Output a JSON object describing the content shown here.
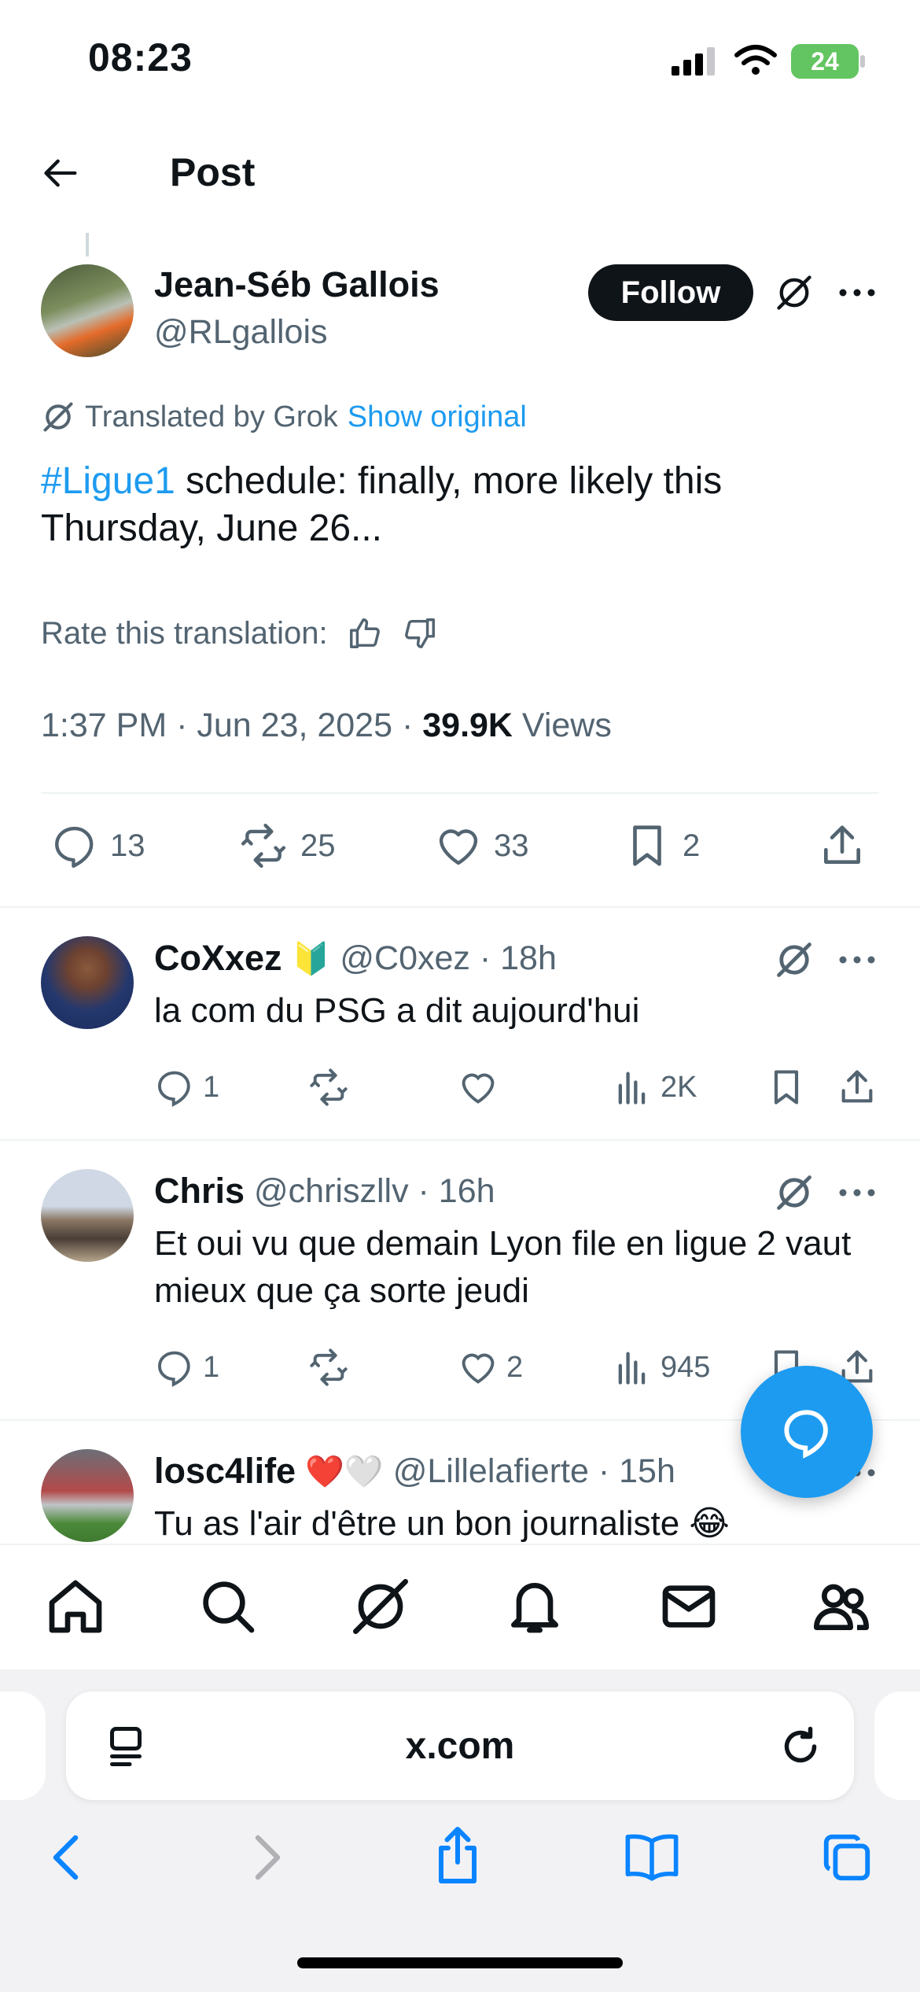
{
  "status_bar": {
    "time": "08:23",
    "battery": "24"
  },
  "header": {
    "title": "Post"
  },
  "post": {
    "author_name": "Jean-Séb Gallois",
    "author_handle": "@RLgallois",
    "follow_label": "Follow",
    "translated_by": "Translated by Grok",
    "show_original": "Show original",
    "hashtag": "#Ligue1",
    "text": " schedule: finally, more likely this Thursday, June 26...",
    "rate_label": "Rate this translation:",
    "meta_prefix": "1:37 PM · Jun 23, 2025 · ",
    "views_count": "39.9K",
    "views_label": " Views",
    "stats": {
      "replies": "13",
      "reposts": "25",
      "likes": "33",
      "bookmarks": "2"
    }
  },
  "replies": [
    {
      "name": "CoXxez",
      "badge": "🔰",
      "meta": "@C0xez · 18h",
      "text": "la com du PSG a dit aujourd'hui",
      "replies": "1",
      "reposts": "",
      "likes": "",
      "views": "2K"
    },
    {
      "name": "Chris",
      "meta": "@chriszllv · 16h",
      "text": "Et oui vu que demain Lyon file en ligue 2 vaut mieux que ça sorte jeudi",
      "replies": "1",
      "reposts": "",
      "likes": "2",
      "views": "945"
    },
    {
      "name": "losc4life",
      "badge": "❤️🤍",
      "meta": "@Lillelafierte · 15h",
      "text": "Tu as l'air d'être un bon journaliste 😂"
    }
  ],
  "browser": {
    "url": "x.com"
  },
  "colors": {
    "accent": "#1d9bf0",
    "text": "#0f1419",
    "secondary": "#536471"
  }
}
